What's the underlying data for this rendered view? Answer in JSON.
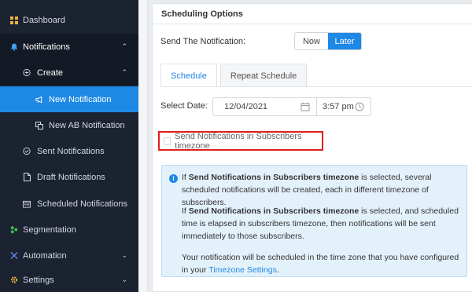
{
  "sidebar": {
    "items": {
      "dashboard": "Dashboard",
      "notifications": "Notifications",
      "create": "Create",
      "new_notification": "New Notification",
      "new_ab_notification": "New AB Notification",
      "sent_notifications": "Sent Notifications",
      "draft_notifications": "Draft Notifications",
      "scheduled_notifications": "Scheduled Notifications",
      "segmentation": "Segmentation",
      "automation": "Automation",
      "settings": "Settings"
    }
  },
  "card": {
    "title": "Scheduling Options"
  },
  "send": {
    "label": "Send The Notification:",
    "now": "Now",
    "later": "Later",
    "selected": "Later"
  },
  "tabs": {
    "schedule": "Schedule",
    "repeat": "Repeat Schedule"
  },
  "date": {
    "label": "Select Date:",
    "value": "12/04/2021",
    "time": "3:57 pm"
  },
  "timezone_checkbox": {
    "label": "Send Notifications in Subscribers timezone",
    "checked": false
  },
  "info": {
    "p1_prefix": "If",
    "p1_bold": "Send Notifications in Subscribers timezone",
    "p1_rest": "is selected, several scheduled notifications will be created, each in different timezone of subscribers.",
    "p2_prefix": "If",
    "p2_bold": "Send Notifications in Subscribers timezone",
    "p2_rest": "is selected, and scheduled time is elapsed in subscribers timezone, then notifications will be sent immediately to those subscribers.",
    "p3_text": "Your notification will be scheduled in the time zone that you have configured in your",
    "p3_link": "Timezone Settings",
    "p3_end": "."
  },
  "colors": {
    "sidebar_bg": "#1b2230",
    "accent": "#1e88e5",
    "highlight_border": "#e0201e",
    "info_bg": "#e3f1fb"
  }
}
